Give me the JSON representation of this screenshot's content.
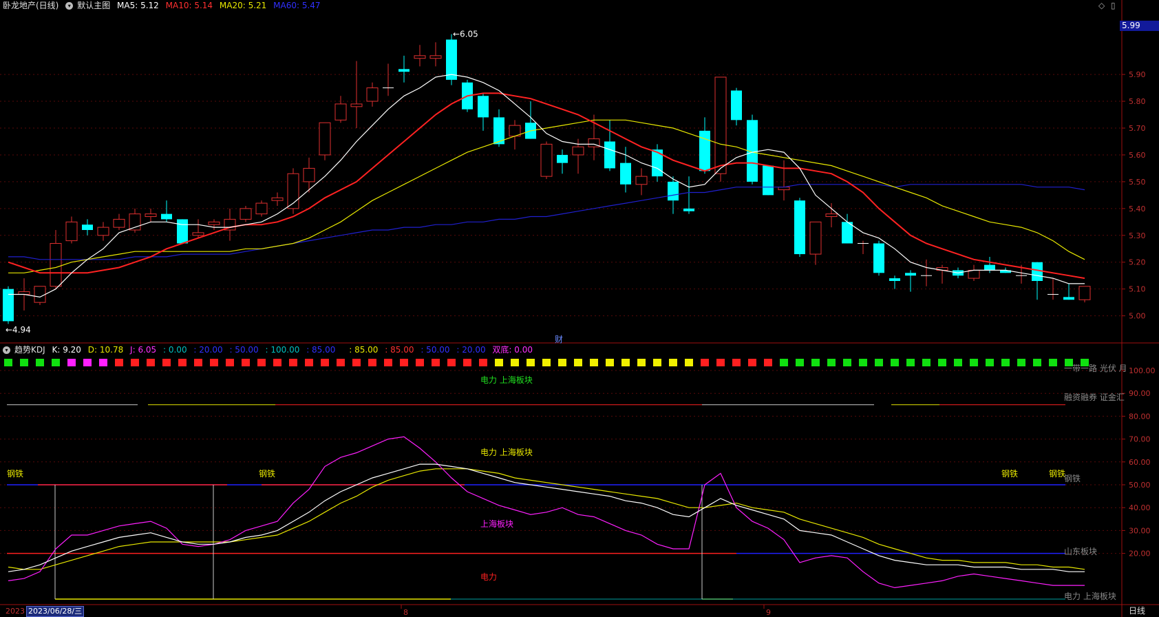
{
  "header": {
    "stock_name": "卧龙地产(日线)",
    "template_label": "默认主图",
    "ma5": "MA5: 5.12",
    "ma10": "MA10: 5.14",
    "ma20": "MA20: 5.21",
    "ma60": "MA60: 5.47"
  },
  "colors": {
    "ma5": "#ffffff",
    "ma10": "#ff2222",
    "ma20": "#e8e800",
    "ma60": "#2020d0",
    "up": "#e03030",
    "down": "#00ffff",
    "bg": "#000000"
  },
  "price_axis": {
    "ticks": [
      "5.90",
      "5.80",
      "5.70",
      "5.60",
      "5.50",
      "5.40",
      "5.30",
      "5.20",
      "5.10",
      "5.00"
    ],
    "current_price": "5.99",
    "high_label": "6.05",
    "low_label": "4.94"
  },
  "main_panel_marker": "财",
  "kdj_header": {
    "title": "趋势KDJ",
    "k": "K: 9.20",
    "d": "D: 10.78",
    "j": "J: 6.05",
    "v1": ": 0.00",
    "v2": ": 20.00",
    "v3": ": 50.00",
    "v4": ": 100.00",
    "v5": ": 85.00",
    "v6": ": 85.00",
    "v7": ": 85.00",
    "v8": ": 50.00",
    "v9": ": 20.00",
    "bottom": "双底: 0.00"
  },
  "kdj_axis": {
    "ticks": [
      "100.00",
      "90.00",
      "80.00",
      "70.00",
      "60.00",
      "50.00",
      "40.00",
      "30.00",
      "20.00"
    ]
  },
  "kdj_labels": {
    "l1": "电力 上海板块",
    "l2": "电力 上海板块",
    "l3": "上海板块",
    "l4": "电力",
    "steel_a": "钢铁",
    "steel_b": "钢铁",
    "steel_c": "钢铁",
    "steel_d": "钢铁",
    "right_top": "一带一路 光伏 月",
    "right_mid": "融资融券 证金汇",
    "right_steel": "钢铁",
    "right_sd": "山东板块",
    "right_bot": "电力 上海板块"
  },
  "x_axis": {
    "year": "2023",
    "date_cursor": "2023/06/28/三",
    "month_8": "8",
    "month_9": "9",
    "mode": "日线"
  },
  "chart_data": {
    "type": "candlestick",
    "series": [
      {
        "name": "K",
        "ohlc": [
          [
            5.1,
            5.11,
            4.97,
            4.98
          ],
          [
            5.08,
            5.14,
            5.02,
            5.09
          ],
          [
            5.05,
            5.11,
            5.04,
            5.11
          ],
          [
            5.11,
            5.32,
            5.1,
            5.27
          ],
          [
            5.28,
            5.37,
            5.27,
            5.35
          ],
          [
            5.34,
            5.36,
            5.3,
            5.32
          ],
          [
            5.3,
            5.35,
            5.28,
            5.33
          ],
          [
            5.33,
            5.38,
            5.32,
            5.36
          ],
          [
            5.32,
            5.4,
            5.31,
            5.38
          ],
          [
            5.37,
            5.4,
            5.35,
            5.38
          ],
          [
            5.38,
            5.43,
            5.35,
            5.36
          ],
          [
            5.36,
            5.36,
            5.27,
            5.27
          ],
          [
            5.3,
            5.36,
            5.29,
            5.31
          ],
          [
            5.34,
            5.36,
            5.32,
            5.35
          ],
          [
            5.32,
            5.4,
            5.28,
            5.36
          ],
          [
            5.36,
            5.41,
            5.35,
            5.4
          ],
          [
            5.38,
            5.43,
            5.37,
            5.42
          ],
          [
            5.43,
            5.46,
            5.41,
            5.44
          ],
          [
            5.4,
            5.55,
            5.38,
            5.53
          ],
          [
            5.5,
            5.59,
            5.46,
            5.55
          ],
          [
            5.6,
            5.65,
            5.58,
            5.72
          ],
          [
            5.73,
            5.82,
            5.72,
            5.79
          ],
          [
            5.78,
            5.95,
            5.7,
            5.79
          ],
          [
            5.8,
            5.87,
            5.78,
            5.85
          ],
          [
            5.85,
            5.94,
            5.82,
            5.85
          ],
          [
            5.92,
            5.97,
            5.87,
            5.91
          ],
          [
            5.96,
            6.01,
            5.93,
            5.97
          ],
          [
            5.96,
            6.02,
            5.93,
            5.97
          ],
          [
            6.03,
            6.05,
            5.86,
            5.88
          ],
          [
            5.87,
            5.88,
            5.76,
            5.77
          ],
          [
            5.82,
            5.83,
            5.69,
            5.74
          ],
          [
            5.74,
            5.77,
            5.63,
            5.64
          ],
          [
            5.67,
            5.73,
            5.62,
            5.71
          ],
          [
            5.72,
            5.8,
            5.66,
            5.66
          ],
          [
            5.52,
            5.65,
            5.51,
            5.64
          ],
          [
            5.6,
            5.62,
            5.53,
            5.57
          ],
          [
            5.6,
            5.66,
            5.53,
            5.63
          ],
          [
            5.63,
            5.75,
            5.58,
            5.66
          ],
          [
            5.65,
            5.73,
            5.54,
            5.55
          ],
          [
            5.57,
            5.63,
            5.46,
            5.49
          ],
          [
            5.49,
            5.55,
            5.45,
            5.52
          ],
          [
            5.62,
            5.64,
            5.5,
            5.52
          ],
          [
            5.5,
            5.52,
            5.38,
            5.43
          ],
          [
            5.4,
            5.52,
            5.38,
            5.39
          ],
          [
            5.69,
            5.74,
            5.53,
            5.54
          ],
          [
            5.53,
            5.89,
            5.5,
            5.89
          ],
          [
            5.84,
            5.85,
            5.71,
            5.73
          ],
          [
            5.73,
            5.75,
            5.49,
            5.5
          ],
          [
            5.56,
            5.56,
            5.45,
            5.45
          ],
          [
            5.47,
            5.58,
            5.43,
            5.48
          ],
          [
            5.43,
            5.44,
            5.22,
            5.23
          ],
          [
            5.23,
            5.34,
            5.19,
            5.35
          ],
          [
            5.37,
            5.42,
            5.33,
            5.38
          ],
          [
            5.35,
            5.38,
            5.27,
            5.27
          ],
          [
            5.27,
            5.28,
            5.23,
            5.27
          ],
          [
            5.27,
            5.28,
            5.15,
            5.16
          ],
          [
            5.14,
            5.15,
            5.1,
            5.13
          ],
          [
            5.16,
            5.17,
            5.09,
            5.15
          ],
          [
            5.15,
            5.21,
            5.11,
            5.15
          ],
          [
            5.17,
            5.19,
            5.12,
            5.18
          ],
          [
            5.17,
            5.18,
            5.14,
            5.15
          ],
          [
            5.14,
            5.19,
            5.13,
            5.17
          ],
          [
            5.19,
            5.22,
            5.16,
            5.17
          ],
          [
            5.17,
            5.18,
            5.16,
            5.16
          ],
          [
            5.15,
            5.19,
            5.12,
            5.15
          ],
          [
            5.2,
            5.2,
            5.06,
            5.13
          ],
          [
            5.08,
            5.14,
            5.06,
            5.08
          ],
          [
            5.07,
            5.12,
            5.06,
            5.06
          ],
          [
            5.06,
            5.11,
            5.05,
            5.11
          ]
        ]
      },
      {
        "name": "MA5",
        "values": [
          5.08,
          5.08,
          5.07,
          5.1,
          5.16,
          5.21,
          5.25,
          5.31,
          5.33,
          5.35,
          5.35,
          5.34,
          5.34,
          5.33,
          5.33,
          5.34,
          5.35,
          5.38,
          5.42,
          5.47,
          5.52,
          5.58,
          5.65,
          5.71,
          5.77,
          5.82,
          5.85,
          5.89,
          5.9,
          5.89,
          5.87,
          5.84,
          5.79,
          5.74,
          5.68,
          5.65,
          5.64,
          5.64,
          5.62,
          5.6,
          5.57,
          5.55,
          5.51,
          5.48,
          5.49,
          5.55,
          5.59,
          5.61,
          5.62,
          5.61,
          5.55,
          5.45,
          5.4,
          5.35,
          5.31,
          5.29,
          5.25,
          5.2,
          5.18,
          5.17,
          5.16,
          5.17,
          5.17,
          5.17,
          5.16,
          5.15,
          5.14,
          5.12,
          5.12
        ]
      },
      {
        "name": "MA10",
        "values": [
          5.2,
          5.18,
          5.16,
          5.16,
          5.16,
          5.16,
          5.17,
          5.18,
          5.2,
          5.22,
          5.25,
          5.27,
          5.29,
          5.31,
          5.33,
          5.34,
          5.34,
          5.35,
          5.37,
          5.4,
          5.44,
          5.47,
          5.5,
          5.55,
          5.6,
          5.65,
          5.7,
          5.75,
          5.79,
          5.82,
          5.83,
          5.83,
          5.82,
          5.81,
          5.79,
          5.77,
          5.75,
          5.72,
          5.69,
          5.66,
          5.63,
          5.61,
          5.58,
          5.56,
          5.54,
          5.56,
          5.57,
          5.57,
          5.56,
          5.55,
          5.55,
          5.54,
          5.53,
          5.5,
          5.46,
          5.4,
          5.35,
          5.3,
          5.27,
          5.25,
          5.23,
          5.21,
          5.2,
          5.19,
          5.18,
          5.17,
          5.16,
          5.15,
          5.14
        ]
      },
      {
        "name": "MA20",
        "values": [
          5.16,
          5.16,
          5.17,
          5.18,
          5.2,
          5.21,
          5.22,
          5.23,
          5.24,
          5.24,
          5.24,
          5.24,
          5.24,
          5.24,
          5.24,
          5.25,
          5.25,
          5.26,
          5.27,
          5.29,
          5.32,
          5.35,
          5.39,
          5.43,
          5.46,
          5.49,
          5.52,
          5.55,
          5.58,
          5.61,
          5.63,
          5.65,
          5.67,
          5.69,
          5.7,
          5.71,
          5.72,
          5.73,
          5.73,
          5.73,
          5.72,
          5.71,
          5.7,
          5.68,
          5.66,
          5.64,
          5.63,
          5.61,
          5.6,
          5.59,
          5.58,
          5.57,
          5.56,
          5.54,
          5.52,
          5.5,
          5.48,
          5.46,
          5.44,
          5.41,
          5.39,
          5.37,
          5.35,
          5.34,
          5.33,
          5.31,
          5.28,
          5.24,
          5.21
        ]
      },
      {
        "name": "MA60",
        "values": [
          5.22,
          5.22,
          5.21,
          5.21,
          5.21,
          5.21,
          5.21,
          5.21,
          5.22,
          5.22,
          5.22,
          5.23,
          5.23,
          5.23,
          5.23,
          5.24,
          5.25,
          5.26,
          5.27,
          5.28,
          5.29,
          5.3,
          5.31,
          5.32,
          5.32,
          5.33,
          5.33,
          5.34,
          5.34,
          5.35,
          5.35,
          5.36,
          5.36,
          5.37,
          5.37,
          5.38,
          5.39,
          5.4,
          5.41,
          5.42,
          5.43,
          5.44,
          5.45,
          5.46,
          5.46,
          5.47,
          5.48,
          5.48,
          5.48,
          5.48,
          5.49,
          5.49,
          5.49,
          5.49,
          5.49,
          5.49,
          5.48,
          5.49,
          5.49,
          5.49,
          5.49,
          5.49,
          5.49,
          5.49,
          5.49,
          5.48,
          5.48,
          5.48,
          5.47
        ]
      },
      {
        "name": "KDJ-K",
        "values": [
          12,
          13,
          15,
          18,
          21,
          23,
          25,
          27,
          28,
          29,
          27,
          25,
          24,
          24,
          25,
          27,
          28,
          30,
          34,
          38,
          43,
          47,
          50,
          53,
          55,
          57,
          59,
          59,
          58,
          57,
          55,
          53,
          51,
          50,
          49,
          48,
          47,
          46,
          45,
          43,
          42,
          40,
          37,
          36,
          40,
          44,
          41,
          39,
          37,
          35,
          30,
          29,
          28,
          25,
          22,
          19,
          17,
          16,
          15,
          15,
          15,
          14,
          14,
          14,
          13,
          13,
          13,
          12,
          12
        ]
      },
      {
        "name": "KDJ-D",
        "values": [
          14,
          13,
          13,
          15,
          17,
          19,
          21,
          23,
          24,
          25,
          25,
          25,
          25,
          25,
          25,
          26,
          27,
          28,
          31,
          34,
          38,
          42,
          45,
          49,
          52,
          54,
          56,
          57,
          57,
          57,
          56,
          55,
          53,
          52,
          51,
          50,
          49,
          48,
          47,
          46,
          45,
          44,
          42,
          40,
          40,
          41,
          42,
          40,
          39,
          38,
          35,
          33,
          31,
          29,
          27,
          24,
          22,
          20,
          18,
          17,
          17,
          16,
          16,
          16,
          15,
          15,
          14,
          14,
          13
        ]
      },
      {
        "name": "KDJ-J",
        "values": [
          8,
          9,
          12,
          22,
          28,
          28,
          30,
          32,
          33,
          34,
          31,
          24,
          23,
          24,
          26,
          30,
          32,
          34,
          42,
          48,
          58,
          62,
          64,
          67,
          70,
          71,
          66,
          60,
          53,
          47,
          44,
          41,
          39,
          37,
          38,
          40,
          37,
          36,
          33,
          30,
          28,
          24,
          22,
          22,
          50,
          55,
          40,
          34,
          31,
          26,
          16,
          18,
          19,
          18,
          12,
          7,
          5,
          6,
          7,
          8,
          10,
          11,
          10,
          9,
          8,
          7,
          6,
          6,
          6
        ]
      }
    ],
    "band_colors": [
      "green",
      "green",
      "green",
      "green",
      "magenta",
      "magenta",
      "magenta",
      "red",
      "red",
      "red",
      "red",
      "red",
      "red",
      "red",
      "red",
      "red",
      "red",
      "red",
      "red",
      "red",
      "red",
      "red",
      "red",
      "red",
      "red",
      "red",
      "red",
      "red",
      "red",
      "red",
      "red",
      "yellow",
      "yellow",
      "yellow",
      "yellow",
      "yellow",
      "yellow",
      "yellow",
      "yellow",
      "yellow",
      "yellow",
      "yellow",
      "yellow",
      "yellow",
      "red",
      "red",
      "red",
      "red",
      "red",
      "green",
      "green",
      "green",
      "green",
      "green",
      "green",
      "green",
      "green",
      "green",
      "green",
      "green",
      "green",
      "green",
      "green",
      "green",
      "green",
      "green",
      "green",
      "green",
      "green"
    ],
    "ylim_price": [
      4.94,
      6.08
    ],
    "ylim_kdj": [
      0,
      100
    ]
  }
}
